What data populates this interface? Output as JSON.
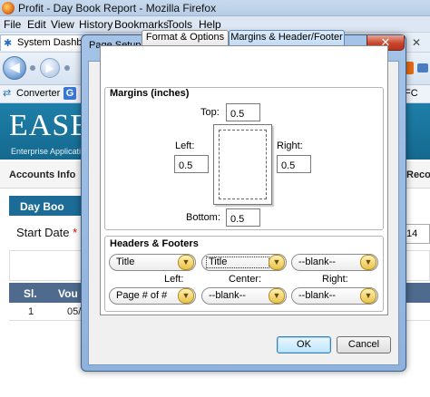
{
  "firefox": {
    "title": "Profit - Day Book Report - Mozilla Firefox",
    "menu": [
      "File",
      "Edit",
      "View",
      "History",
      "Bookmarks",
      "Tools",
      "Help"
    ],
    "tab_label": "System Dashbo",
    "bookmarks": {
      "converter": "Converter",
      "right_text": "FC"
    }
  },
  "page": {
    "brand": "EASE",
    "brand_sub": "Enterprise Applicati",
    "nav_left": "Accounts Info",
    "nav_right": "Reco",
    "section_tab": "Day Boo",
    "start_date_label": "Start Date",
    "required_mark": "*",
    "right_date": "14",
    "table": {
      "headers": [
        "Sl.",
        "Vou"
      ],
      "rows": [
        [
          "1",
          "05/"
        ]
      ]
    }
  },
  "dialog": {
    "title": "Page Setup",
    "close_glyph": "✕",
    "tabs": [
      {
        "label": "Format & Options",
        "active": false
      },
      {
        "label": "Margins & Header/Footer",
        "active": true
      }
    ],
    "margins": {
      "group_title": "Margins (inches)",
      "top_label": "Top:",
      "top": "0.5",
      "left_label": "Left:",
      "left": "0.5",
      "right_label": "Right:",
      "right": "0.5",
      "bottom_label": "Bottom:",
      "bottom": "0.5"
    },
    "headers_footers": {
      "group_title": "Headers & Footers",
      "header": {
        "left": "Title",
        "center": "Title",
        "right": "--blank--"
      },
      "footer": {
        "left": "Page # of #",
        "center": "--blank--",
        "right": "--blank--"
      },
      "col_left": "Left:",
      "col_center": "Center:",
      "col_right": "Right:"
    },
    "buttons": {
      "ok": "OK",
      "cancel": "Cancel"
    }
  },
  "colors": {
    "banner": "#1e7fa8",
    "dialog_frame": "#9bbbe2",
    "close_button": "#c8452c"
  }
}
